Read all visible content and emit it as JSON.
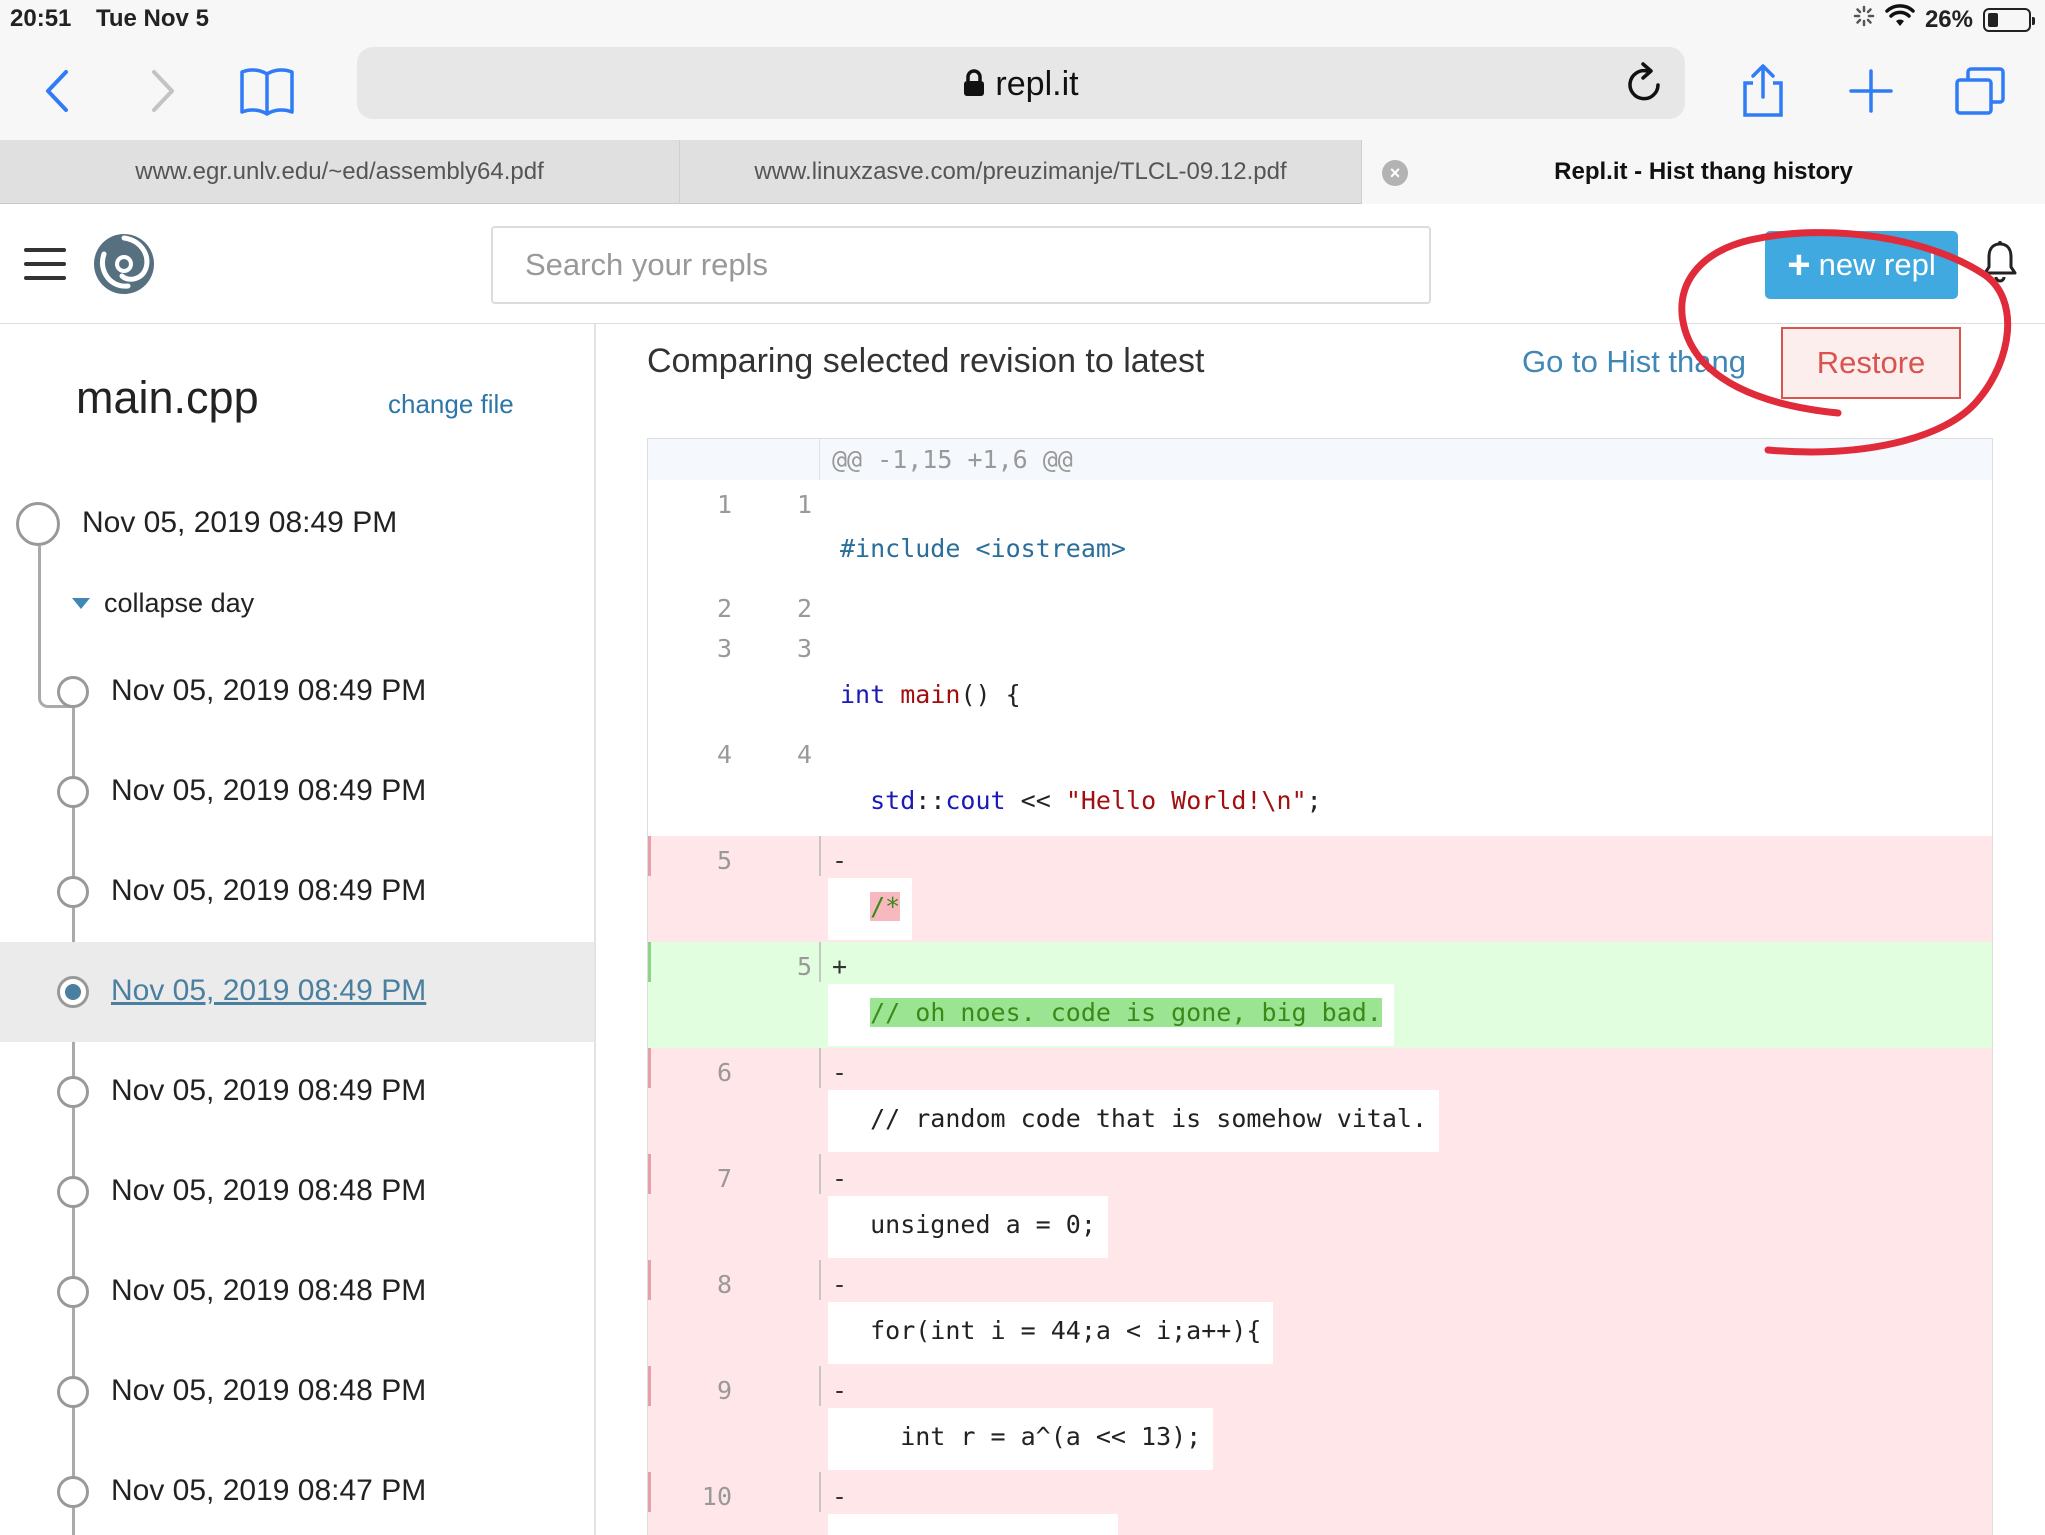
{
  "status_bar": {
    "time": "20:51",
    "date": "Tue Nov 5",
    "battery": "26%"
  },
  "browser": {
    "url": "repl.it",
    "tabs": [
      {
        "title": "www.egr.unlv.edu/~ed/assembly64.pdf"
      },
      {
        "title": "www.linuxzasve.com/preuzimanje/TLCL-09.12.pdf"
      },
      {
        "title": "Repl.it - Hist thang history",
        "active": true
      }
    ]
  },
  "header": {
    "search_placeholder": "Search your repls",
    "new_repl_label": "new repl",
    "accent_color": "#3fa9e0"
  },
  "sidebar": {
    "filename": "main.cpp",
    "change_file_label": "change file",
    "first_revision": "Nov 05, 2019 08:49 PM",
    "collapse_label": "collapse day",
    "revisions": [
      {
        "date": "Nov 05, 2019 08:49 PM",
        "selected": false
      },
      {
        "date": "Nov 05, 2019 08:49 PM",
        "selected": false
      },
      {
        "date": "Nov 05, 2019 08:49 PM",
        "selected": false
      },
      {
        "date": "Nov 05, 2019 08:49 PM",
        "selected": true
      },
      {
        "date": "Nov 05, 2019 08:49 PM",
        "selected": false
      },
      {
        "date": "Nov 05, 2019 08:48 PM",
        "selected": false
      },
      {
        "date": "Nov 05, 2019 08:48 PM",
        "selected": false
      },
      {
        "date": "Nov 05, 2019 08:48 PM",
        "selected": false
      },
      {
        "date": "Nov 05, 2019 08:47 PM",
        "selected": false
      }
    ]
  },
  "main": {
    "title": "Comparing selected revision to latest",
    "goto_label": "Go to Hist thang",
    "restore_label": "Restore",
    "diff": {
      "hunk_header": "@@ -1,15 +1,6 @@",
      "lines": [
        {
          "type": "ctx",
          "old": "1",
          "new": "1",
          "text": "#include <iostream>"
        },
        {
          "type": "ctx",
          "old": "2",
          "new": "2",
          "text": ""
        },
        {
          "type": "ctx",
          "old": "3",
          "new": "3",
          "text": "int main() {"
        },
        {
          "type": "ctx",
          "old": "4",
          "new": "4",
          "text": "  std::cout << \"Hello World!\\n\";"
        },
        {
          "type": "del",
          "old": "5",
          "new": "",
          "mark": "-",
          "text": "  /*"
        },
        {
          "type": "add",
          "old": "",
          "new": "5",
          "mark": "+",
          "text": "  // oh noes. code is gone, big bad."
        },
        {
          "type": "del",
          "old": "6",
          "new": "",
          "mark": "-",
          "text": "  // random code that is somehow vital."
        },
        {
          "type": "del",
          "old": "7",
          "new": "",
          "mark": "-",
          "text": "  unsigned a = 0;"
        },
        {
          "type": "del",
          "old": "8",
          "new": "",
          "mark": "-",
          "text": "  for(int i = 44;a < i;a++){"
        },
        {
          "type": "del",
          "old": "9",
          "new": "",
          "mark": "-",
          "text": "    int r = a^(a << 13);"
        },
        {
          "type": "del",
          "old": "10",
          "new": "",
          "mark": "-",
          "text": ""
        }
      ]
    }
  }
}
